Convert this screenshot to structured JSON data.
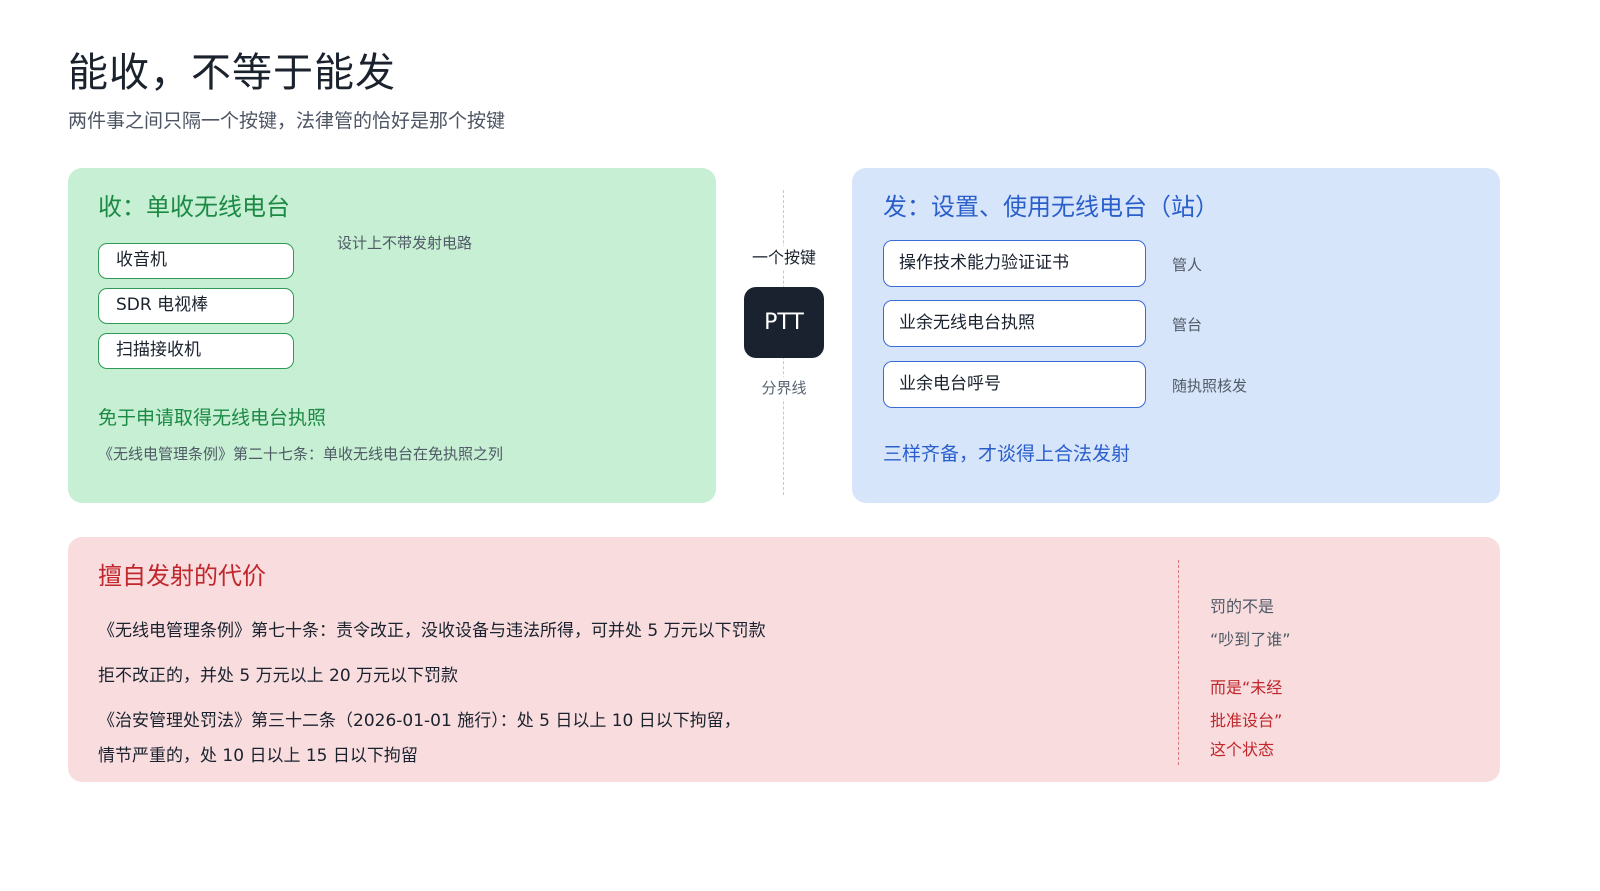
{
  "page": {
    "title": "能收，不等于能发",
    "subtitle": "两件事之间只隔一个按键，法律管的恰好是那个按键"
  },
  "receive": {
    "heading": "收：单收无线电台",
    "devices": [
      "收音机",
      "SDR 电视棒",
      "扫描接收机"
    ],
    "note": "设计上不带发射电路",
    "exempt": "免于申请取得无线电台执照",
    "law": "《无线电管理条例》第二十七条：单收无线电台在免执照之列"
  },
  "center": {
    "top_label": "一个按键",
    "key_label": "PTT",
    "bottom_label": "分界线"
  },
  "transmit": {
    "heading": "发：设置、使用无线电台（站）",
    "requirements": [
      {
        "label": "操作技术能力验证证书",
        "note": "管人"
      },
      {
        "label": "业余无线电台执照",
        "note": "管台"
      },
      {
        "label": "业余电台呼号",
        "note": "随执照核发"
      }
    ],
    "summary": "三样齐备，才谈得上合法发射"
  },
  "penalty": {
    "heading": "擅自发射的代价",
    "lines": [
      "《无线电管理条例》第七十条：责令改正，没收设备与违法所得，可并处 5 万元以下罚款",
      "拒不改正的，并处 5 万元以上 20 万元以下罚款",
      "《治安管理处罚法》第三十二条（2026-01-01 施行）：处 5 日以上 10 日以下拘留，",
      "情节严重的，处 10 日以上 15 日以下拘留"
    ],
    "side_gray": [
      "罚的不是",
      "“吵到了谁”"
    ],
    "side_red": [
      "而是“未经",
      "批准设台”",
      "这个状态"
    ]
  },
  "colors": {
    "receive_bg": "#c6efd3",
    "receive_accent": "#1c8a45",
    "transmit_bg": "#d7e5fb",
    "transmit_accent": "#2a5fcb",
    "penalty_bg": "#f8dcde",
    "penalty_accent": "#c0262b",
    "key_bg": "#1a2230"
  }
}
